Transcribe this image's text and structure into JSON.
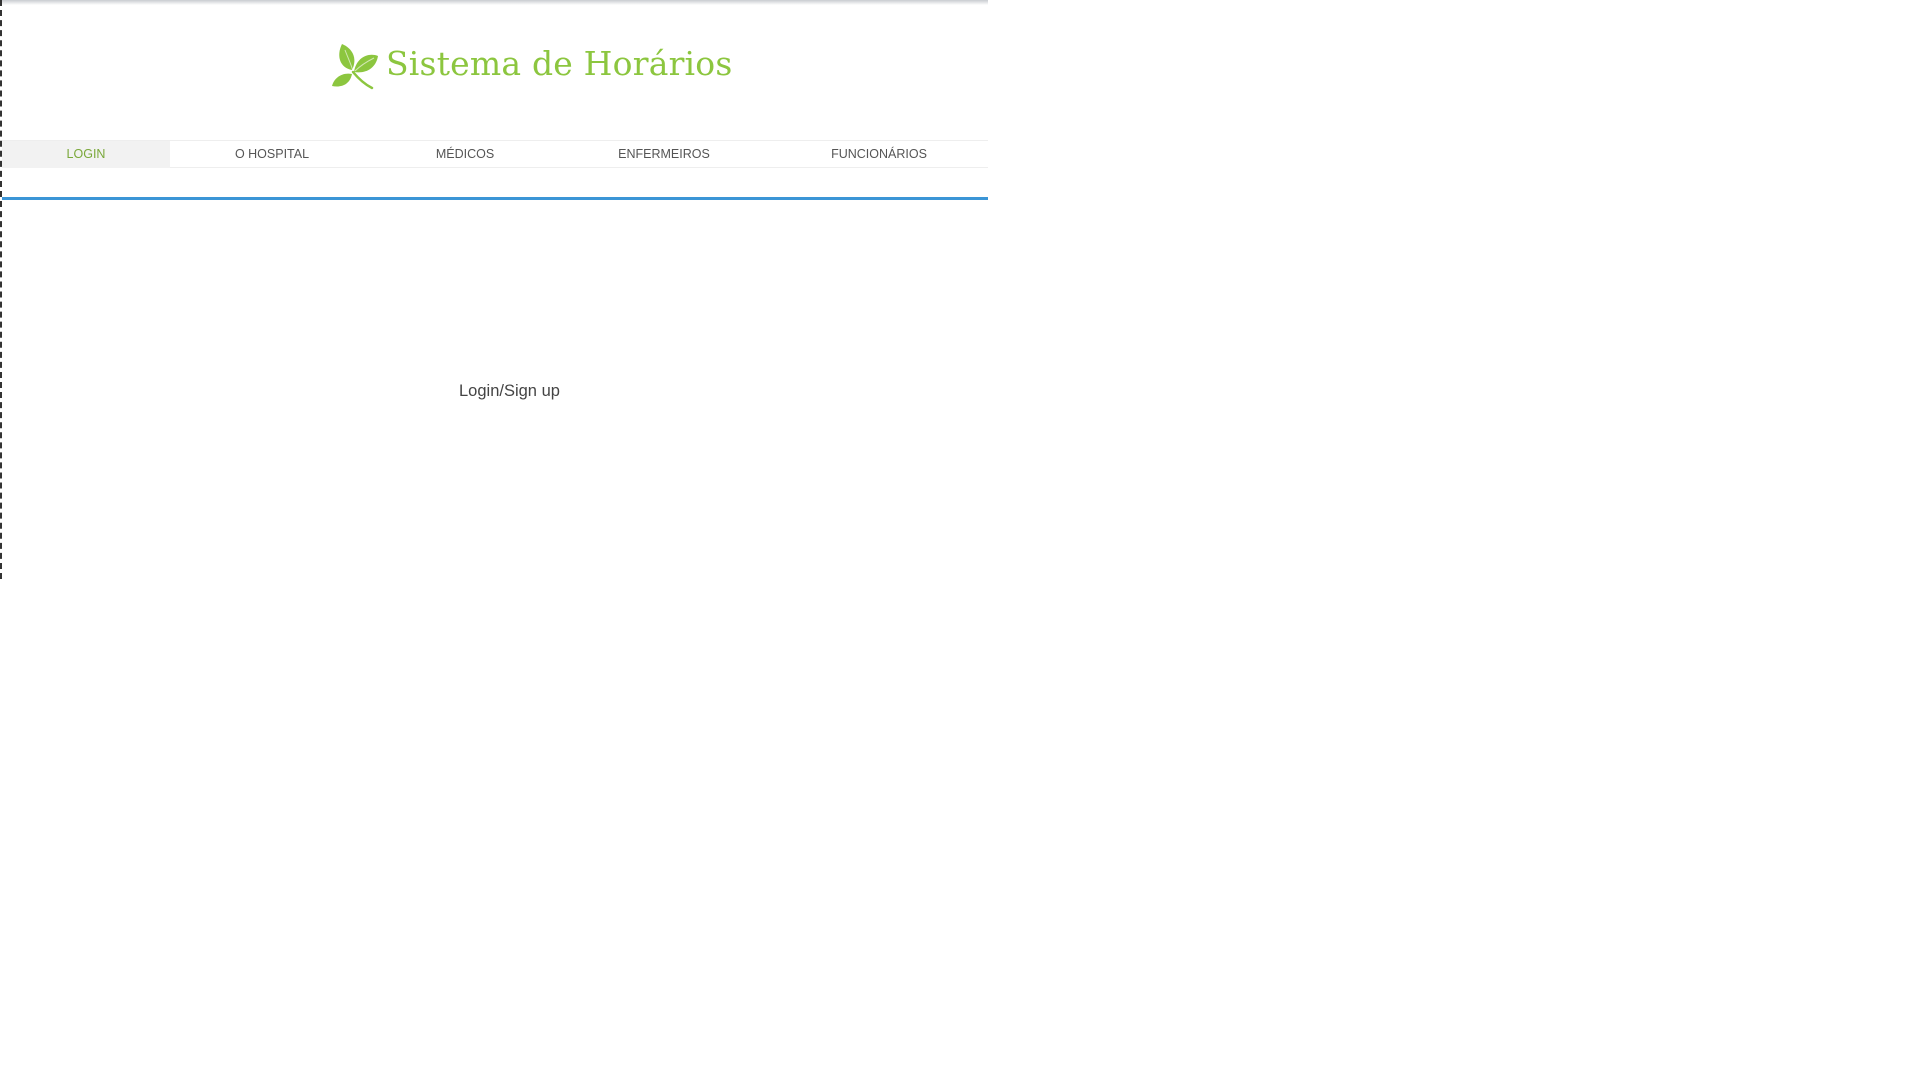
{
  "header": {
    "title": "Sistema de Horários",
    "logo_icon": "leaf-icon",
    "title_color": "#8cc63f"
  },
  "nav": {
    "items": [
      {
        "label": "LOGIN",
        "active": true
      },
      {
        "label": "O HOSPITAL",
        "active": false
      },
      {
        "label": "MÉDICOS",
        "active": false
      },
      {
        "label": "ENFERMEIROS",
        "active": false
      },
      {
        "label": "FUNCIONÁRIOS",
        "active": false
      }
    ],
    "active_color": "#7aa83a",
    "divider_color": "#3b95d6"
  },
  "main": {
    "login_link": "Login/Sign up"
  }
}
